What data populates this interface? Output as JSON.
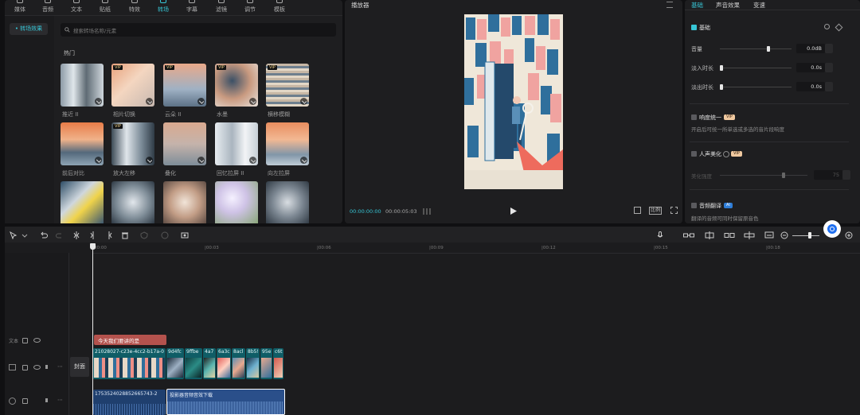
{
  "top_tabs": [
    {
      "label": "媒体",
      "icon": "media-icon"
    },
    {
      "label": "音频",
      "icon": "audio-icon"
    },
    {
      "label": "文本",
      "icon": "text-icon"
    },
    {
      "label": "贴纸",
      "icon": "sticker-icon"
    },
    {
      "label": "特效",
      "icon": "effects-icon"
    },
    {
      "label": "转场",
      "icon": "transition-icon",
      "active": true
    },
    {
      "label": "字幕",
      "icon": "caption-icon"
    },
    {
      "label": "滤镜",
      "icon": "filter-icon"
    },
    {
      "label": "调节",
      "icon": "adjust-icon"
    },
    {
      "label": "模板",
      "icon": "template-icon"
    }
  ],
  "sidebar": {
    "active_item": "• 转场效果"
  },
  "search": {
    "placeholder": "搜索转场名称/元素"
  },
  "category_label": "热门",
  "transitions": [
    {
      "name": "推近 II",
      "vip": false
    },
    {
      "name": "相片切换",
      "vip": true
    },
    {
      "name": "云朵 II",
      "vip": true
    },
    {
      "name": "水墨",
      "vip": true
    },
    {
      "name": "横移模糊",
      "vip": true
    },
    {
      "name": "前后对比",
      "vip": false
    },
    {
      "name": "放大左移",
      "vip": true
    },
    {
      "name": "叠化",
      "vip": false
    },
    {
      "name": "回忆拉屏 II",
      "vip": false
    },
    {
      "name": "向左拉屏",
      "vip": false
    },
    {
      "name": "",
      "vip": false
    },
    {
      "name": "",
      "vip": false
    },
    {
      "name": "",
      "vip": false
    },
    {
      "name": "",
      "vip": false
    },
    {
      "name": "",
      "vip": false
    }
  ],
  "vip_label": "VIP",
  "player": {
    "title": "播放器",
    "current_time": "00:00:00:00",
    "total_time": "00:00:05:03",
    "ratio_label": "比例"
  },
  "right_panel": {
    "tabs": [
      "基础",
      "声音效果",
      "变速"
    ],
    "section_basic": "基础",
    "volume_label": "音量",
    "volume_value": "0.0dB",
    "fadein_label": "淡入时长",
    "fadein_value": "0.0s",
    "fadeout_label": "淡出时长",
    "fadeout_value": "0.0s",
    "loudness_label": "响度统一",
    "loudness_desc": "开启后可统一所单选或多选的音片段响度",
    "voice_label": "人声美化",
    "voice_sub_label": "美化强度",
    "voice_value": "75",
    "translate_label": "音频翻译",
    "translate_badge": "AI",
    "translate_desc": "翻译的音频可同时保留原音色"
  },
  "timeline": {
    "ruler": [
      "00:00",
      "|00:03",
      "|00:06",
      "|00:09",
      "|00:12",
      "|00:15",
      "|00:18"
    ],
    "text_clip": "今天我们要讲的是",
    "cover_label": "封面",
    "video_clip_label": "21028027-c23e-4cc2-b17a-0",
    "small_clip_labels": [
      "9d4fc",
      "9ffbe",
      "4a7",
      "6a3c",
      "8acl",
      "8b5!",
      "95e",
      "c6t"
    ],
    "audio_clip_1": "1753524028852665743-2",
    "audio_clip_2": "投影器音频音效下载"
  },
  "colors": {
    "accent": "#37c6d6",
    "text_clip": "#b4524d",
    "video_clip": "#0f5d66",
    "audio_clip": "#2a4f8a"
  }
}
